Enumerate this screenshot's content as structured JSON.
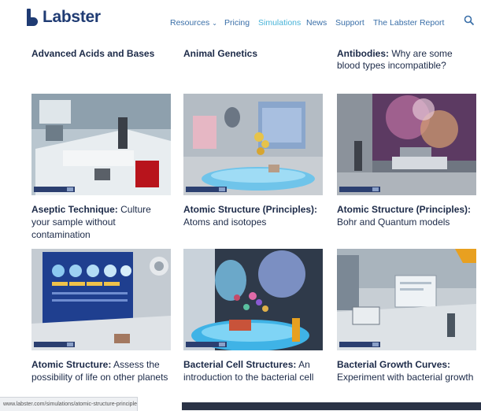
{
  "header": {
    "logo_text": "Labster",
    "nav": [
      "Resources",
      "Pricing",
      "Simulations",
      "News",
      "Support",
      "The Labster Report"
    ],
    "active_nav": "Simulations"
  },
  "top_row": [
    {
      "bold": "Advanced Acids and Bases",
      "rest": ""
    },
    {
      "bold": "Animal Genetics",
      "rest": ""
    },
    {
      "bold": "Antibodies:",
      "rest": " Why are some blood types incompatible?"
    }
  ],
  "cards": [
    {
      "bold": "Aseptic Technique:",
      "rest": " Culture your sample without contamination"
    },
    {
      "bold": "Atomic Structure (Principles):",
      "rest": " Atoms and isotopes"
    },
    {
      "bold": "Atomic Structure (Principles):",
      "rest": " Bohr and Quantum models"
    },
    {
      "bold": "Atomic Structure:",
      "rest": " Assess the possibility of life on other planets"
    },
    {
      "bold": "Bacterial Cell Structures:",
      "rest": " An introduction to the bacterial cell"
    },
    {
      "bold": "Bacterial Growth Curves:",
      "rest": " Experiment with bacterial growth"
    }
  ],
  "status_url": "www.labster.com/simulations/atomic-structure-principles/",
  "colors": {
    "brand": "#1f3b73",
    "nav": "#3a6fa8",
    "nav_active": "#47b3d8",
    "title": "#1c2a48"
  },
  "icons": {
    "search": "search-icon",
    "nav_dropdown": "chevron-down-icon"
  }
}
